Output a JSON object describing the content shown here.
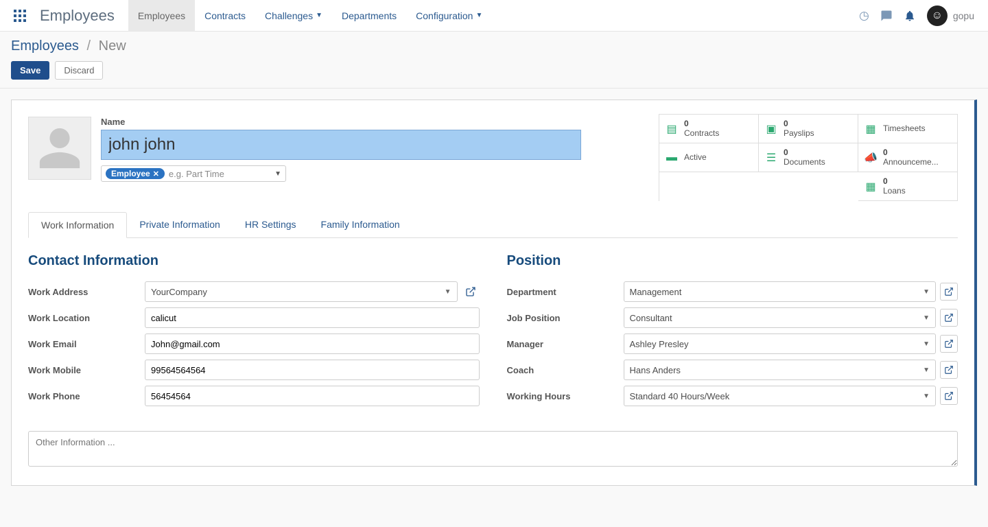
{
  "navbar": {
    "brand": "Employees",
    "menu": [
      "Employees",
      "Contracts",
      "Challenges",
      "Departments",
      "Configuration"
    ],
    "username": "gopu"
  },
  "breadcrumb": {
    "root": "Employees",
    "current": "New"
  },
  "actions": {
    "save": "Save",
    "discard": "Discard"
  },
  "form": {
    "name_label": "Name",
    "name_value": "john john",
    "tag": "Employee",
    "tag_placeholder": "e.g. Part Time"
  },
  "stats": {
    "contracts": {
      "count": "0",
      "label": "Contracts"
    },
    "payslips": {
      "count": "0",
      "label": "Payslips"
    },
    "timesheets": {
      "label": "Timesheets"
    },
    "active": {
      "label": "Active"
    },
    "documents": {
      "count": "0",
      "label": "Documents"
    },
    "announcements": {
      "count": "0",
      "label": "Announceme..."
    },
    "loans": {
      "count": "0",
      "label": "Loans"
    }
  },
  "tabs": [
    "Work Information",
    "Private Information",
    "HR Settings",
    "Family Information"
  ],
  "sections": {
    "contact": {
      "title": "Contact Information",
      "work_address_label": "Work Address",
      "work_address": "YourCompany",
      "work_location_label": "Work Location",
      "work_location": "calicut",
      "work_email_label": "Work Email",
      "work_email": "John@gmail.com",
      "work_mobile_label": "Work Mobile",
      "work_mobile": "99564564564",
      "work_phone_label": "Work Phone",
      "work_phone": "56454564"
    },
    "position": {
      "title": "Position",
      "department_label": "Department",
      "department": "Management",
      "job_label": "Job Position",
      "job": "Consultant",
      "manager_label": "Manager",
      "manager": "Ashley Presley",
      "coach_label": "Coach",
      "coach": "Hans Anders",
      "hours_label": "Working Hours",
      "hours": "Standard 40 Hours/Week"
    }
  },
  "notes_placeholder": "Other Information ..."
}
